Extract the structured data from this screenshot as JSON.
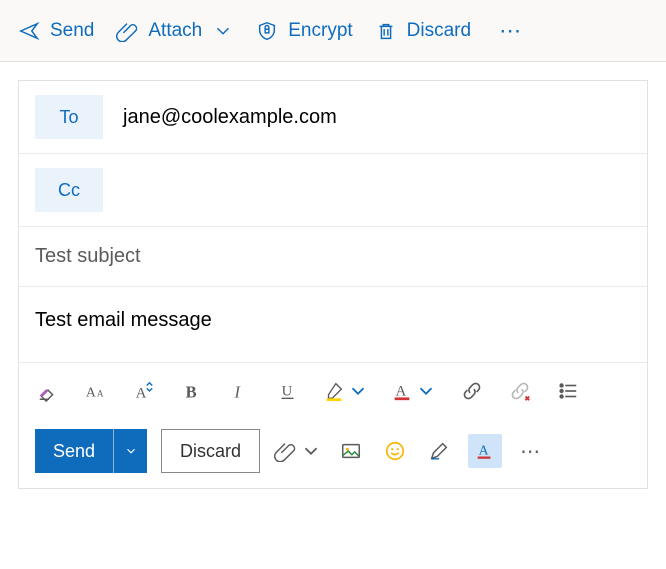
{
  "topbar": {
    "send": "Send",
    "attach": "Attach",
    "encrypt": "Encrypt",
    "discard": "Discard"
  },
  "compose": {
    "to_label": "To",
    "to_value": "jane@coolexample.com",
    "cc_label": "Cc",
    "subject": "Test subject",
    "body": "Test email message"
  },
  "bottom": {
    "send": "Send",
    "discard": "Discard"
  },
  "colors": {
    "accent": "#0f6cbd",
    "highlight_yellow": "#ffd500",
    "font_color_red": "#d13438"
  }
}
